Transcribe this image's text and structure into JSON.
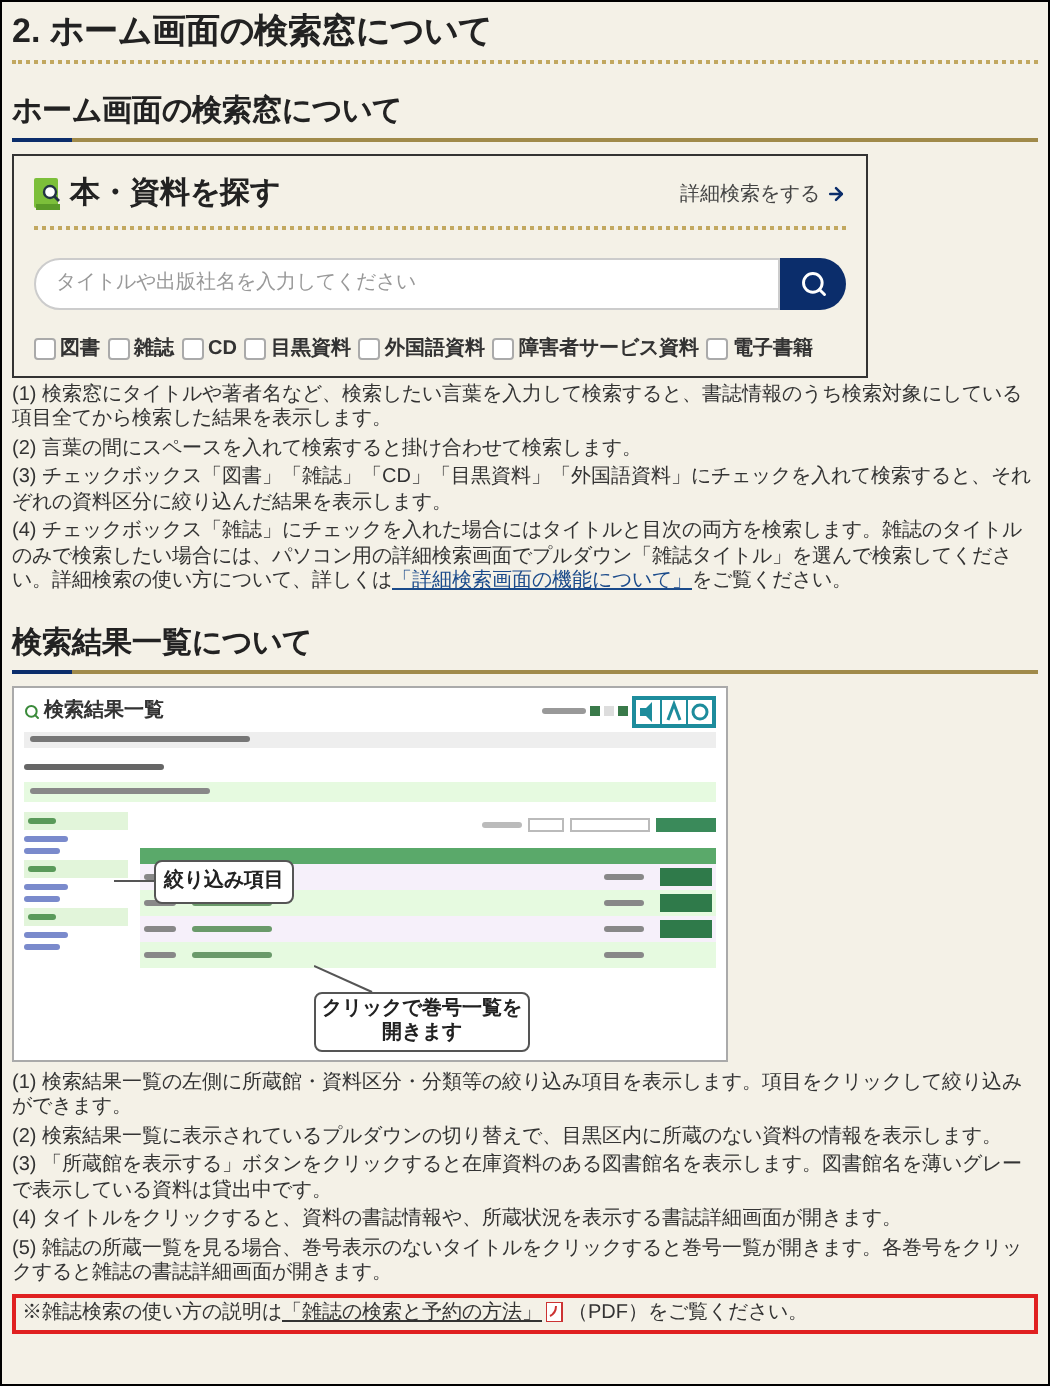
{
  "page_title": "2. ホーム画面の検索窓について",
  "search_section": {
    "heading": "ホーム画面の検索窓について",
    "search_box": {
      "title": "本・資料を探す",
      "advanced_link": "詳細検索をする",
      "placeholder": "タイトルや出版社名を入力してください",
      "checkboxes": [
        {
          "label": "図書",
          "checked": false
        },
        {
          "label": "雑誌",
          "checked": false
        },
        {
          "label": "CD",
          "checked": false
        },
        {
          "label": "目黒資料",
          "checked": false
        },
        {
          "label": "外国語資料",
          "checked": false
        },
        {
          "label": "障害者サービス資料",
          "checked": false
        },
        {
          "label": "電子書籍",
          "checked": false
        }
      ]
    },
    "notes": [
      {
        "text": "(1) 検索窓にタイトルや著者名など、検索したい言葉を入力して検索すると、書誌情報のうち検索対象にしている項目全てから検索した結果を表示します。"
      },
      {
        "text": "(2) 言葉の間にスペースを入れて検索すると掛け合わせて検索します。"
      },
      {
        "text": "(3) チェックボックス「図書」「雑誌」「CD」「目黒資料」「外国語資料」にチェックを入れて検索すると、それぞれの資料区分に絞り込んだ結果を表示します。"
      },
      {
        "text": "(4) チェックボックス「雑誌」にチェックを入れた場合にはタイトルと目次の両方を検索します。雑誌のタイトルのみで検索したい場合には、パソコン用の詳細検索画面でプルダウン「雑誌タイトル」を選んで検索してください。詳細検索の使い方について、詳しくは",
        "link": "「詳細検索画面の機能について」",
        "after": "をご覧ください。"
      }
    ]
  },
  "results_section": {
    "heading": "検索結果一覧について",
    "screenshot": {
      "title": "検索結果一覧",
      "callouts": [
        "絞り込み項目",
        "クリックで巻号一覧を開きます"
      ]
    },
    "notes": [
      {
        "text": "(1) 検索結果一覧の左側に所蔵館・資料区分・分類等の絞り込み項目を表示します。項目をクリックして絞り込みができます。"
      },
      {
        "text": "(2) 検索結果一覧に表示されているプルダウンの切り替えで、目黒区内に所蔵のない資料の情報を表示します。"
      },
      {
        "text": "(3) 「所蔵館を表示する」ボタンをクリックすると在庫資料のある図書館名を表示します。図書館名を薄いグレーで表示している資料は貸出中です。"
      },
      {
        "text": "(4) タイトルをクリックすると、資料の書誌情報や、所蔵状況を表示する書誌詳細画面が開きます。"
      },
      {
        "text": "(5) 雑誌の所蔵一覧を見る場合、巻号表示のないタイトルをクリックすると巻号一覧が開きます。各巻号をクリックすると雑誌の書誌詳細画面が開きます。"
      }
    ]
  },
  "notice": {
    "before": "※雑誌検索の使い方の説明は",
    "link": "「雑誌の検索と予約の方法」",
    "after": "（PDF）をご覧ください。"
  }
}
